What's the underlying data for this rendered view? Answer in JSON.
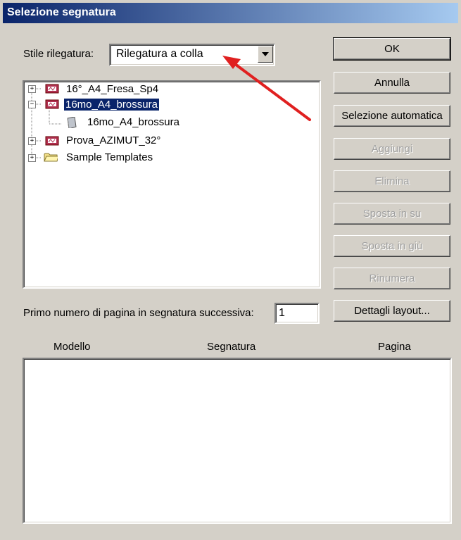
{
  "window": {
    "title": "Selezione segnatura"
  },
  "binding_style": {
    "label": "Stile rilegatura:",
    "value": "Rilegatura a colla"
  },
  "tree": {
    "items": [
      {
        "label": "16°_A4_Fresa_Sp4"
      },
      {
        "label": "16mo_A4_brossura"
      },
      {
        "label": "16mo_A4_brossura"
      },
      {
        "label": "Prova_AZIMUT_32°"
      },
      {
        "label": "Sample Templates"
      }
    ]
  },
  "buttons": {
    "ok": "OK",
    "annulla": "Annulla",
    "selezione_automatica": "Selezione automatica",
    "aggiungi": "Aggiungi",
    "elimina": "Elimina",
    "sposta_su": "Sposta in su",
    "sposta_giu": "Sposta in giù",
    "rinumera": "Rinumera",
    "dettagli_layout": "Dettagli layout..."
  },
  "first_page": {
    "label": "Primo numero di pagina in segnatura successiva:",
    "value": "1"
  },
  "list": {
    "columns": [
      "Modello",
      "Segnatura",
      "Pagina"
    ]
  },
  "colors": {
    "title_bar": "#0a246a",
    "selection": "#0a246a",
    "arrow": "#e02020",
    "background": "#d4d0c8"
  }
}
